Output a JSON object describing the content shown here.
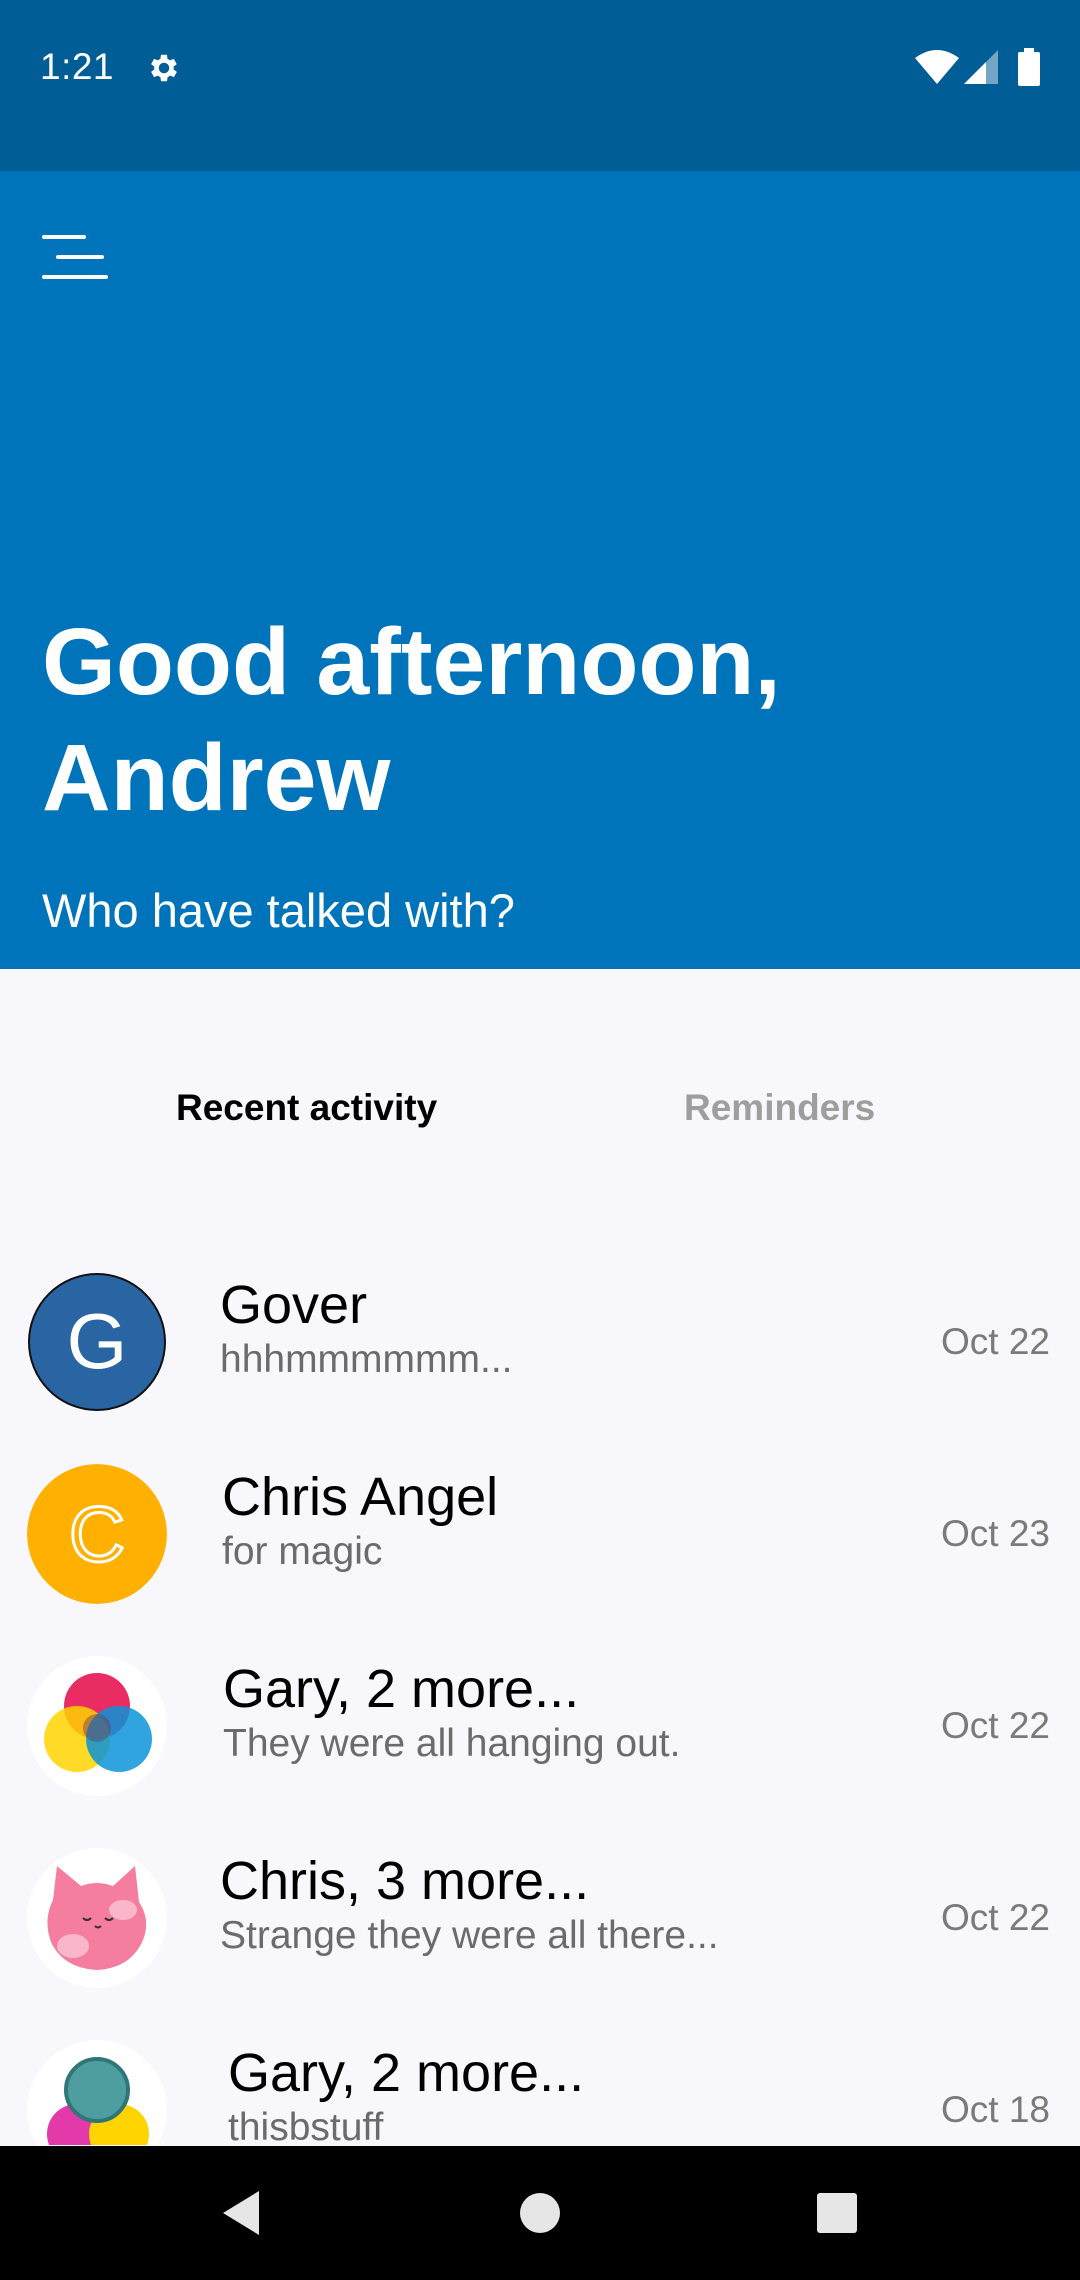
{
  "status_bar": {
    "time": "1:21",
    "icons": [
      "settings-gear-icon",
      "wifi-icon",
      "cellular-signal-icon",
      "battery-icon"
    ]
  },
  "header": {
    "menu_icon": "menu-icon",
    "greeting_line1": "Good afternoon,",
    "greeting_line2": "Andrew",
    "subtitle": "Who have talked with?"
  },
  "tabs": [
    {
      "label": "Recent activity",
      "selected": true
    },
    {
      "label": "Reminders",
      "selected": false
    }
  ],
  "activity": [
    {
      "name": "Gover",
      "preview": "hhhmmmmmm...",
      "date": "Oct 22",
      "avatar_letter": "G",
      "avatar_color": "#2a65a3"
    },
    {
      "name": "Chris Angel",
      "preview": "for magic",
      "date": "Oct 23",
      "avatar_letter": "C",
      "avatar_color": "#ffb000"
    },
    {
      "name": "Gary, 2 more...",
      "preview": "They were all hanging out.",
      "date": "Oct 22",
      "avatar_type": "group-circles"
    },
    {
      "name": "Chris, 3 more...",
      "preview": "Strange they were all there...",
      "date": "Oct 22",
      "avatar_type": "pink-cat"
    },
    {
      "name": "Gary, 2 more...",
      "preview": "thisbstuff",
      "date": "Oct 18",
      "avatar_type": "group-circles-alt"
    }
  ],
  "colors": {
    "status_bar": "#005d95",
    "hero": "#0074bb",
    "background": "#f7f7fc"
  },
  "nav_bar": [
    "back-icon",
    "home-icon",
    "recents-icon"
  ]
}
